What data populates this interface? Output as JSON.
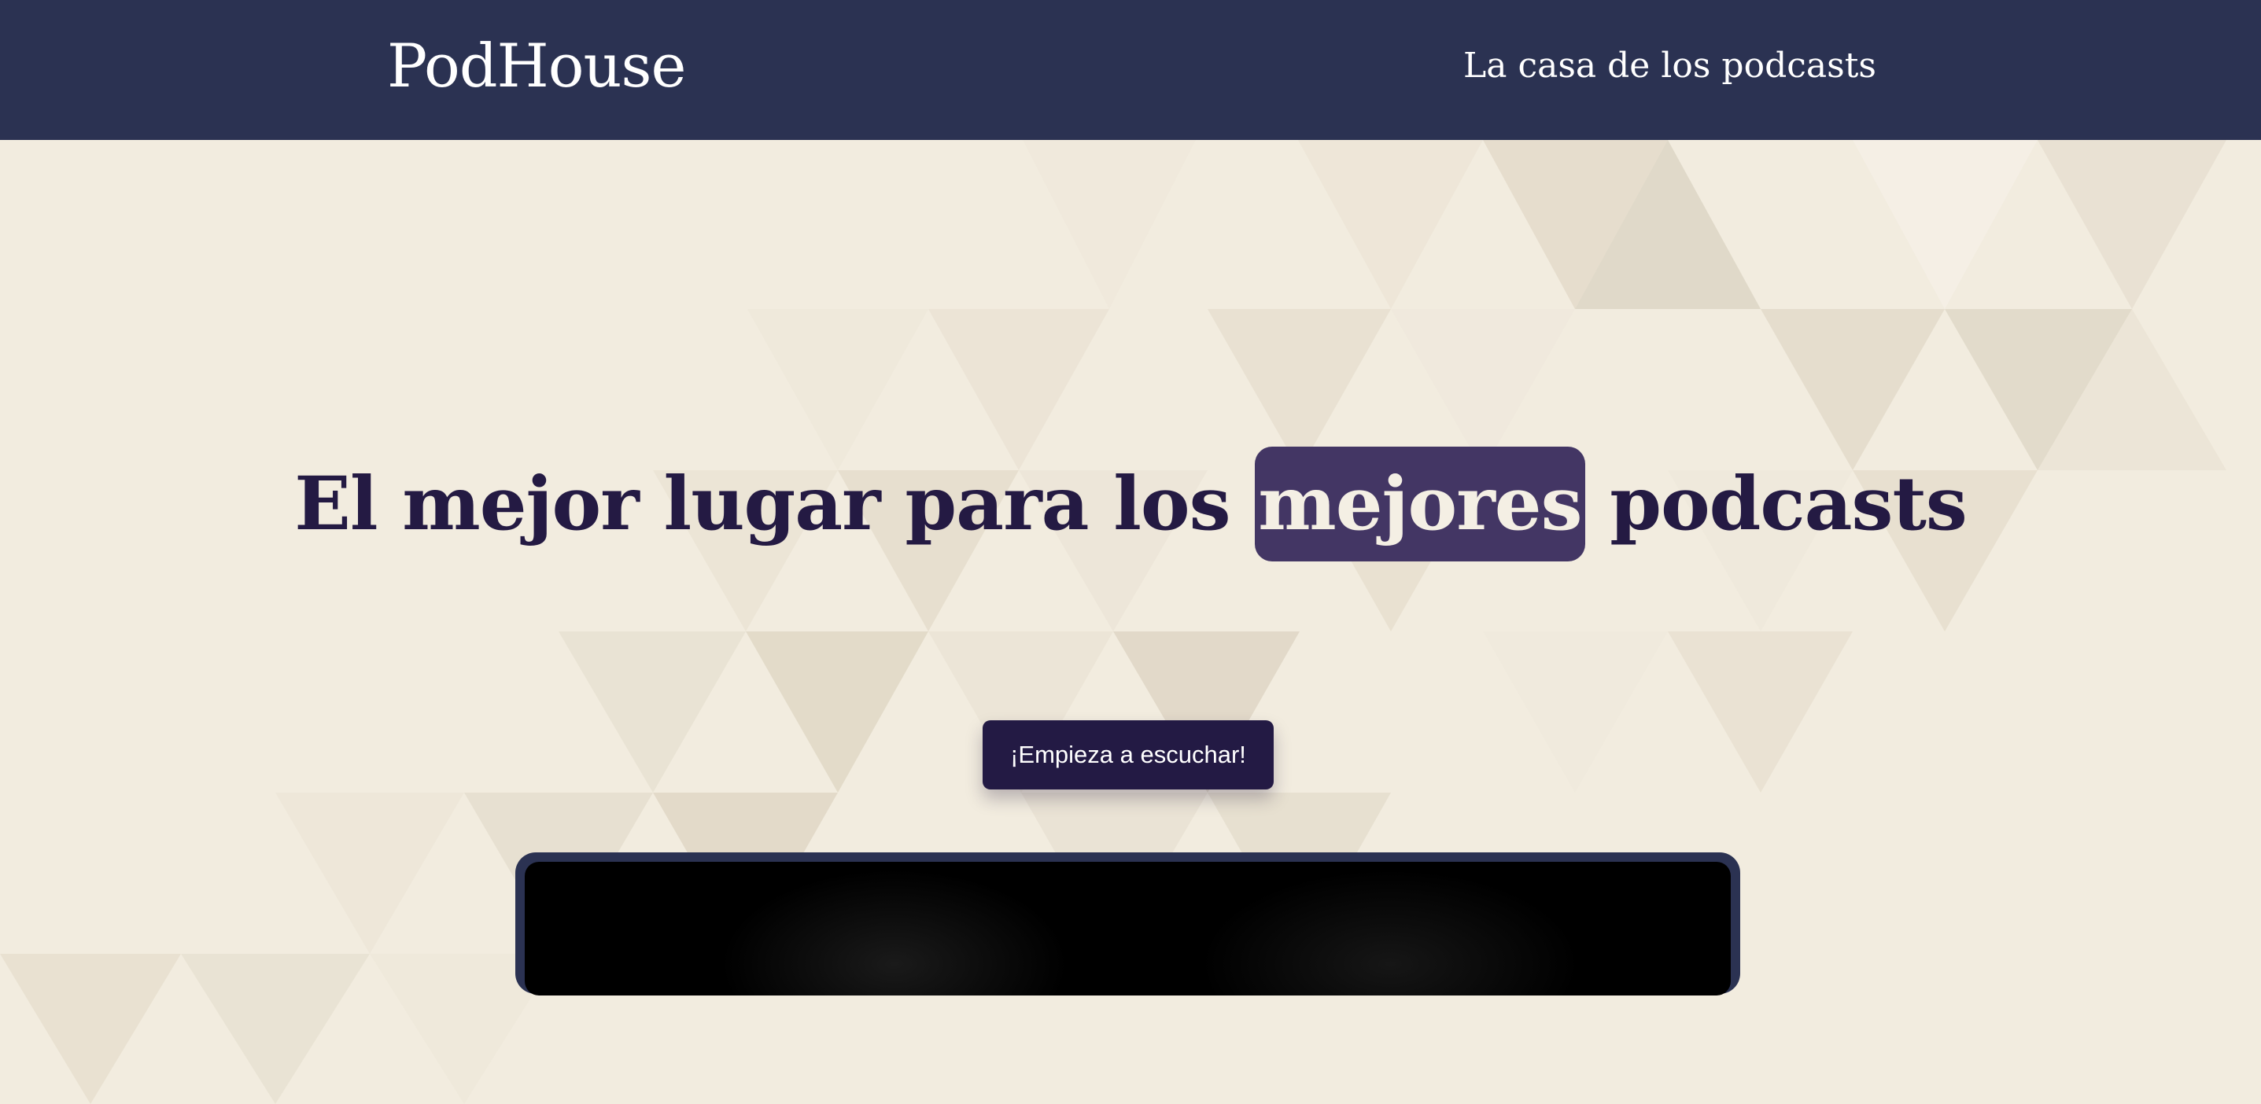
{
  "header": {
    "logo": "PodHouse",
    "tagline": "La casa de los podcasts"
  },
  "hero": {
    "headline_before": "El mejor lugar para los ",
    "headline_highlight": "mejores",
    "headline_after": " podcasts",
    "cta_label": "¡Empieza a escuchar!"
  },
  "colors": {
    "header_bg": "#2b3252",
    "page_bg": "#f2ecdf",
    "headline_text": "#241a43",
    "highlight_bg": "#433664",
    "cta_bg": "#231a44",
    "player_bg": "#000000"
  }
}
